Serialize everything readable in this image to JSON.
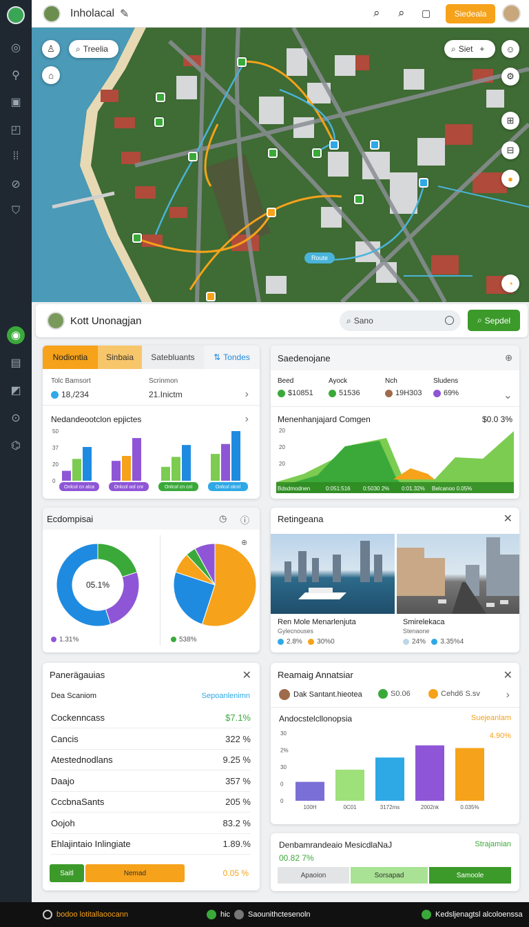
{
  "app": {
    "title": "Inholacal",
    "cta_label": "Siedeala"
  },
  "sidebar": {
    "icons": [
      "globe-icon",
      "pin-icon",
      "image-icon",
      "chart-icon",
      "grid-icon",
      "sphere-icon",
      "shield-icon",
      "leaf-icon",
      "table-icon",
      "tiles-icon",
      "compass-icon",
      "tag-icon"
    ]
  },
  "map": {
    "search_label": "Treelia",
    "right_search_label": "Siet",
    "route_label": "Route"
  },
  "header": {
    "name": "Kott Unonagjan",
    "search_label": "Sano",
    "button_label": "Sepdel"
  },
  "overview": {
    "tabs": [
      "Nodiontia",
      "Sinbaia",
      "Satebluants",
      "Tondes"
    ],
    "stat1_label": "Tolc Bamsort",
    "stat1_value": "18,/234",
    "stat2_label": "Scrinmon",
    "stat2_value": "21.Inictm",
    "chart_title": "Nedandeootclon epjictes",
    "chart_data": {
      "type": "bar",
      "categories": [
        "Onlcol cn alca",
        "Onlcol ool cnr",
        "Onlcol cn cnl",
        "Oolcol olcnl"
      ],
      "ylim": [
        0,
        50
      ],
      "yticks": [
        "50",
        "37",
        "20",
        "0"
      ],
      "series": [
        {
          "values": [
            10,
            20,
            14,
            27
          ]
        },
        {
          "values": [
            22,
            25,
            24,
            37
          ]
        },
        {
          "values": [
            34,
            43,
            36,
            50
          ]
        }
      ],
      "colors": [
        "#8e56d6",
        "#3aa93a",
        "#f6a21a",
        "#1f8be0",
        "#7ccc52"
      ]
    }
  },
  "sales": {
    "title": "Saedenojane",
    "cols": [
      {
        "label": "Beed",
        "value": "$10851",
        "color": "#3aa93a"
      },
      {
        "label": "Ayock",
        "value": "51536",
        "color": "#3aa93a"
      },
      {
        "label": "Nch",
        "value": "19H303",
        "color": "#a06b4a"
      },
      {
        "label": "Sludens",
        "value": "69%",
        "color": "#8e56d6"
      }
    ],
    "chart_title": "Menenhanjajard Comgen",
    "chart_value": "$0.0 3%",
    "chart_data": {
      "type": "area",
      "yticks": [
        "20",
        "20",
        "20"
      ],
      "bottom_labels": [
        "Bdsdmodnen",
        "0:051:516",
        "0:5030 2%",
        "0:01.32%",
        "Belcanoo 0.05%"
      ]
    }
  },
  "donuts": {
    "title": "Ecdompisai",
    "donut_center": "05.1%",
    "legend1_value": "1.31%",
    "legend2_value": "538%",
    "chart_data": [
      {
        "type": "pie",
        "values": [
          20,
          25,
          55
        ],
        "colors": [
          "#3aa93a",
          "#8e56d6",
          "#1f8be0"
        ]
      },
      {
        "type": "pie",
        "values": [
          55,
          25,
          8,
          4,
          8
        ],
        "colors": [
          "#f6a21a",
          "#1f8be0",
          "#f6a21a",
          "#3aa93a",
          "#8e56d6"
        ]
      }
    ]
  },
  "gallery": {
    "title": "Retingeana",
    "items": [
      {
        "title": "Ren Mole Menarlenjuta",
        "subtitle": "Gylecnouses",
        "v1": "2.8%",
        "v2": "30%0"
      },
      {
        "title": "Smirelekaca",
        "subtitle": "Stenaone",
        "v1": "24%",
        "v2": "3.35%4"
      }
    ]
  },
  "percentages": {
    "title": "Panerägauias",
    "col1": "Dea Scaniom",
    "col2": "Sepoanlenimn",
    "rows": [
      {
        "label": "Cockenncass",
        "value": "$7.1%",
        "color": "#3aa93a"
      },
      {
        "label": "Cancis",
        "value": "322 %",
        "color": "#333"
      },
      {
        "label": "Atestednodlans",
        "value": "9.25 %",
        "color": "#333"
      },
      {
        "label": "Daajo",
        "value": "357 %",
        "color": "#333"
      },
      {
        "label": "CccbnaSants",
        "value": "205 %",
        "color": "#333"
      },
      {
        "label": "Oojoh",
        "value": "83.2 %",
        "color": "#333"
      },
      {
        "label": "Ehlajintaio Inlingiate",
        "value": "1.89.%",
        "color": "#333"
      }
    ],
    "footer_btn1": "Saitl",
    "footer_btn2": "Nemad",
    "footer_value": "0.05 %"
  },
  "analysis": {
    "title": "Reamaig Annatsiar",
    "legend_user": "Dak Santant.hieotea",
    "legend1_value": "S0.06",
    "legend2_value": "Cehd6 S.sv",
    "chart_title": "Andocstelcllonopsia",
    "chart_link": "Suejeanlam",
    "chart_value": "4.90%",
    "chart_data": {
      "type": "bar",
      "categories": [
        "100H",
        "0C01",
        "3172ms",
        "2002nk",
        "0.035%"
      ],
      "yticks": [
        "30",
        "2%",
        "30",
        "0",
        "0"
      ],
      "values": [
        14,
        23,
        32,
        41,
        39
      ],
      "colors": [
        "#7a6fd6",
        "#9ee07a",
        "#2fa8e6",
        "#8e56d6",
        "#f6a21a"
      ]
    }
  },
  "progress": {
    "title": "Denbamrandeaio MesicdlaNaJ",
    "link": "Strajamian",
    "value": "00.82 7%",
    "btns": [
      "Apaoion",
      "Sorsapad",
      "Samoole"
    ]
  },
  "footer": {
    "items": [
      "bodoo lotitallaoocann",
      "hic",
      "Saounithctesenoln",
      "Kedsljenagtsl alcoloenssa"
    ]
  }
}
